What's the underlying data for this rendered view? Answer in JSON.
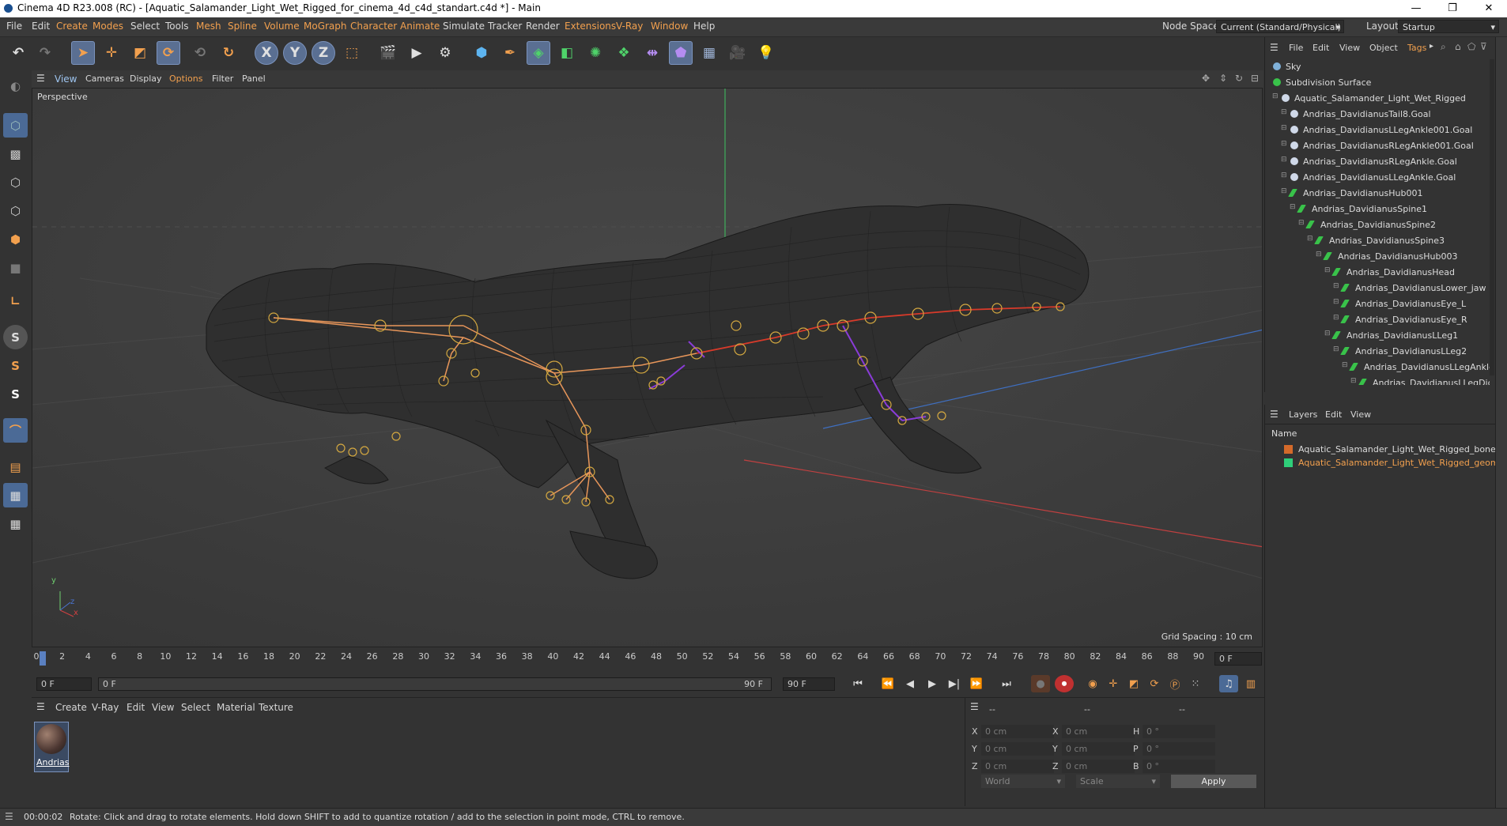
{
  "window": {
    "title": "Cinema 4D R23.008 (RC) - [Aquatic_Salamander_Light_Wet_Rigged_for_cinema_4d_c4d_standart.c4d *] - Main",
    "controls": {
      "minimize": "—",
      "restore": "❐",
      "close": "✕"
    }
  },
  "menubar": {
    "items": [
      "File",
      "Edit",
      "Create",
      "Modes",
      "Select",
      "Tools",
      "Mesh",
      "Spline",
      "Volume",
      "MoGraph",
      "Character",
      "Animate",
      "Simulate",
      "Tracker",
      "Render",
      "Extensions",
      "V-Ray",
      "Window",
      "Help"
    ],
    "node_space_label": "Node Space:",
    "node_space_value": "Current (Standard/Physical)",
    "layout_label": "Layout:",
    "layout_value": "Startup"
  },
  "toolbar": {
    "axis_x": "X",
    "axis_y": "Y",
    "axis_z": "Z"
  },
  "left_tools": {
    "s1": "S",
    "s2": "S",
    "s3": "S"
  },
  "viewport": {
    "menu": [
      "View",
      "Cameras",
      "Display",
      "Options",
      "Filter",
      "Panel"
    ],
    "label": "Perspective",
    "grid_spacing": "Grid Spacing : 10 cm",
    "axis_y": "y",
    "axis_z": "z",
    "axis_x": "x"
  },
  "timeline": {
    "ticks": [
      "0",
      "2",
      "4",
      "6",
      "8",
      "10",
      "12",
      "14",
      "16",
      "18",
      "20",
      "22",
      "24",
      "26",
      "28",
      "30",
      "32",
      "34",
      "36",
      "38",
      "40",
      "42",
      "44",
      "46",
      "48",
      "50",
      "52",
      "54",
      "56",
      "58",
      "60",
      "62",
      "64",
      "66",
      "68",
      "70",
      "72",
      "74",
      "76",
      "78",
      "80",
      "82",
      "84",
      "86",
      "88",
      "90"
    ],
    "current_frame": "0 F",
    "start_field": "0 F",
    "range_start": "0 F",
    "range_end": "90 F",
    "end_field": "90 F"
  },
  "playback": {
    "first": "⏮",
    "prev_key": "⏪",
    "prev": "◀",
    "play": "▶",
    "next": "▶|",
    "next_key": "⏩",
    "last": "⏭"
  },
  "material_manager": {
    "menu": [
      "Create",
      "V-Ray",
      "Edit",
      "View",
      "Select",
      "Material",
      "Texture"
    ],
    "material_name": "Andrias"
  },
  "coordinates": {
    "headers": [
      "--",
      "--",
      "--"
    ],
    "rows": [
      {
        "l1": "X",
        "v1": "0 cm",
        "l2": "X",
        "v2": "0 cm",
        "l3": "H",
        "v3": "0 °"
      },
      {
        "l1": "Y",
        "v1": "0 cm",
        "l2": "Y",
        "v2": "0 cm",
        "l3": "P",
        "v3": "0 °"
      },
      {
        "l1": "Z",
        "v1": "0 cm",
        "l2": "Z",
        "v2": "0 cm",
        "l3": "B",
        "v3": "0 °"
      }
    ],
    "mode": "World",
    "scale": "Scale",
    "apply": "Apply"
  },
  "object_manager": {
    "menu": [
      "File",
      "Edit",
      "View",
      "Object",
      "Tags"
    ],
    "objects": [
      {
        "name": "Sky",
        "depth": 0,
        "icon": "sky",
        "color": "#7fb0d8"
      },
      {
        "name": "Subdivision Surface",
        "depth": 0,
        "icon": "subdiv",
        "color": "#39c24a"
      },
      {
        "name": "Aquatic_Salamander_Light_Wet_Rigged",
        "depth": 1,
        "icon": "null",
        "color": "#cfd8e8"
      },
      {
        "name": "Andrias_DavidianusTail8.Goal",
        "depth": 2,
        "icon": "null",
        "color": "#cfd8e8"
      },
      {
        "name": "Andrias_DavidianusLLegAnkle001.Goal",
        "depth": 2,
        "icon": "null",
        "color": "#cfd8e8"
      },
      {
        "name": "Andrias_DavidianusRLegAnkle001.Goal",
        "depth": 2,
        "icon": "null",
        "color": "#cfd8e8"
      },
      {
        "name": "Andrias_DavidianusRLegAnkle.Goal",
        "depth": 2,
        "icon": "null",
        "color": "#cfd8e8"
      },
      {
        "name": "Andrias_DavidianusLLegAnkle.Goal",
        "depth": 2,
        "icon": "null",
        "color": "#cfd8e8"
      },
      {
        "name": "Andrias_DavidianusHub001",
        "depth": 2,
        "icon": "bone",
        "color": "#39c24a"
      },
      {
        "name": "Andrias_DavidianusSpine1",
        "depth": 3,
        "icon": "bone",
        "color": "#39c24a"
      },
      {
        "name": "Andrias_DavidianusSpine2",
        "depth": 4,
        "icon": "bone",
        "color": "#39c24a"
      },
      {
        "name": "Andrias_DavidianusSpine3",
        "depth": 5,
        "icon": "bone",
        "color": "#39c24a"
      },
      {
        "name": "Andrias_DavidianusHub003",
        "depth": 6,
        "icon": "bone",
        "color": "#39c24a"
      },
      {
        "name": "Andrias_DavidianusHead",
        "depth": 7,
        "icon": "bone",
        "color": "#39c24a"
      },
      {
        "name": "Andrias_DavidianusLower_jaw",
        "depth": 8,
        "icon": "bone",
        "color": "#39c24a"
      },
      {
        "name": "Andrias_DavidianusEye_L",
        "depth": 8,
        "icon": "bone",
        "color": "#39c24a"
      },
      {
        "name": "Andrias_DavidianusEye_R",
        "depth": 8,
        "icon": "bone",
        "color": "#39c24a"
      },
      {
        "name": "Andrias_DavidianusLLeg1",
        "depth": 7,
        "icon": "bone",
        "color": "#39c24a"
      },
      {
        "name": "Andrias_DavidianusLLeg2",
        "depth": 8,
        "icon": "bone",
        "color": "#39c24a"
      },
      {
        "name": "Andrias_DavidianusLLegAnkle",
        "depth": 9,
        "icon": "bone",
        "color": "#39c24a"
      },
      {
        "name": "Andrias_DavidianusLLegDic",
        "depth": 10,
        "icon": "bone",
        "color": "#39c24a"
      }
    ]
  },
  "layers": {
    "menu": [
      "Layers",
      "Edit",
      "View"
    ],
    "column": "Name",
    "items": [
      {
        "name": "Aquatic_Salamander_Light_Wet_Rigged_bones",
        "color": "#d46a2a",
        "text_color": "#dcdcdc"
      },
      {
        "name": "Aquatic_Salamander_Light_Wet_Rigged_geometry",
        "color": "#2fcf7a",
        "text_color": "#f2a04e"
      }
    ]
  },
  "status": {
    "time": "00:00:02",
    "message": "Rotate: Click and drag to rotate elements. Hold down SHIFT to add to quantize rotation / add to the selection in point mode, CTRL to remove."
  },
  "colors": {
    "accent_selected": "#5a6f92",
    "menu_highlight": "#f2a04e",
    "bone_orange": "#e8965a",
    "bone_red": "#d83a2a",
    "bone_purple": "#8a3cd8"
  }
}
